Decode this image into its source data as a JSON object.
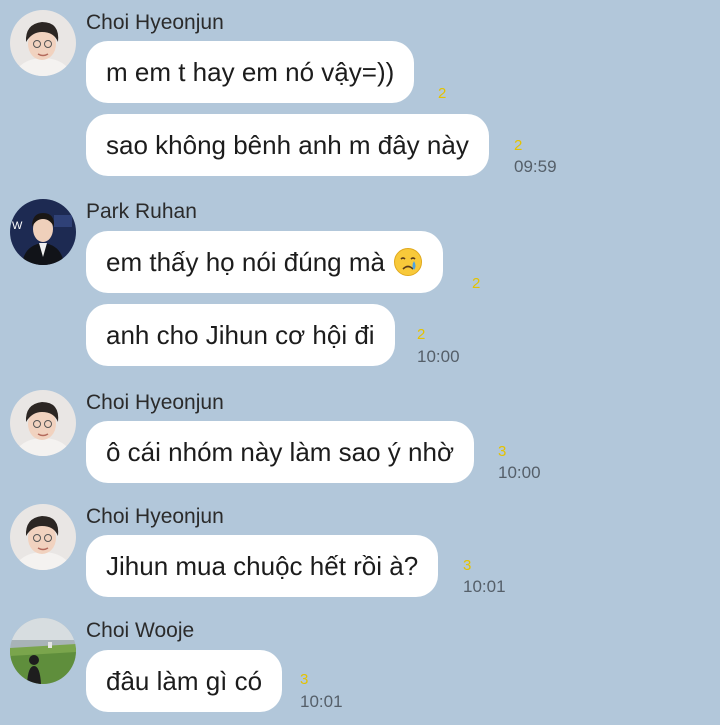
{
  "colors": {
    "background": "#b2c7da",
    "bubble": "#ffffff",
    "unread": "#e4c200",
    "time": "#555f69"
  },
  "groups": [
    {
      "sender": "Choi Hyeonjun",
      "avatar": "avatar-photo-choi-hyeonjun",
      "messages": [
        {
          "text": "m em t hay em nó vậy=))",
          "unread": "2",
          "time": ""
        },
        {
          "text": "sao không bênh anh m đây này",
          "unread": "2",
          "time": "09:59"
        }
      ]
    },
    {
      "sender": "Park Ruhan",
      "avatar": "avatar-photo-park-ruhan",
      "messages": [
        {
          "text": "em thấy họ nói đúng mà",
          "emoji": "crying-face-emoji",
          "unread": "2",
          "time": ""
        },
        {
          "text": "anh cho Jihun cơ hội đi",
          "unread": "2",
          "time": "10:00"
        }
      ]
    },
    {
      "sender": "Choi Hyeonjun",
      "avatar": "avatar-photo-choi-hyeonjun",
      "messages": [
        {
          "text": "ô cái nhóm này làm sao ý nhờ",
          "unread": "3",
          "time": "10:00"
        }
      ]
    },
    {
      "sender": "Choi Hyeonjun",
      "avatar": "avatar-photo-choi-hyeonjun",
      "messages": [
        {
          "text": "Jihun mua chuộc hết rồi à?",
          "unread": "3",
          "time": "10:01"
        }
      ]
    },
    {
      "sender": "Choi Wooje",
      "avatar": "avatar-photo-choi-wooje",
      "messages": [
        {
          "text": "đâu làm gì có",
          "unread": "3",
          "time": "10:01"
        }
      ]
    }
  ]
}
